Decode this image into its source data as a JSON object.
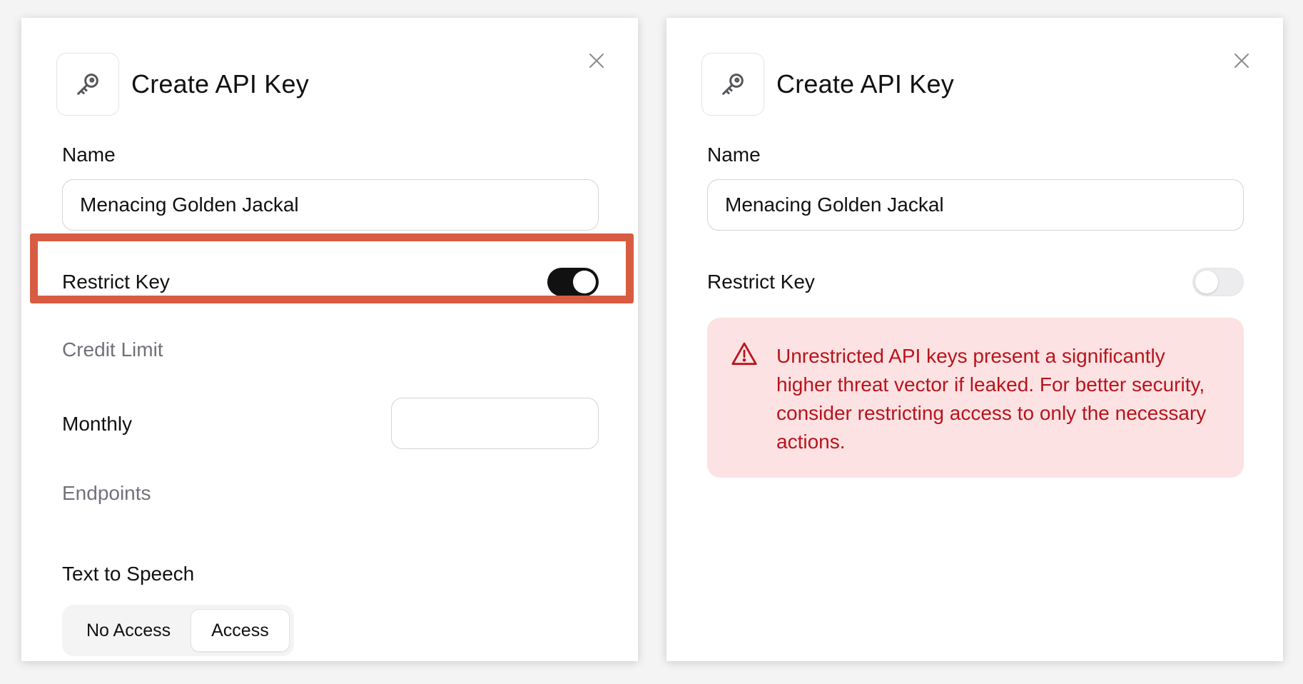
{
  "left_dialog": {
    "title": "Create API Key",
    "name_label": "Name",
    "name_value": "Menacing Golden Jackal",
    "restrict_label": "Restrict Key",
    "restrict_enabled": true,
    "credit_limit_label": "Credit Limit",
    "monthly_label": "Monthly",
    "monthly_value": "",
    "endpoints_label": "Endpoints",
    "tts_label": "Text to Speech",
    "tts_options": [
      "No Access",
      "Access"
    ],
    "tts_selected": "Access"
  },
  "right_dialog": {
    "title": "Create API Key",
    "name_label": "Name",
    "name_value": "Menacing Golden Jackal",
    "restrict_label": "Restrict Key",
    "restrict_enabled": false,
    "warning_text": "Unrestricted API keys present a significantly higher threat vector if leaked. For better security, consider restricting access to only the necessary actions."
  },
  "icons": {
    "key": "key-icon",
    "close": "close-icon",
    "warning": "warning-triangle-icon"
  },
  "colors": {
    "highlight": "#d85c41",
    "toggle_on": "#111111",
    "toggle_off": "#ececee",
    "warning_bg": "#fde2e3",
    "warning_text": "#b8141c",
    "muted_text": "#71717a"
  }
}
